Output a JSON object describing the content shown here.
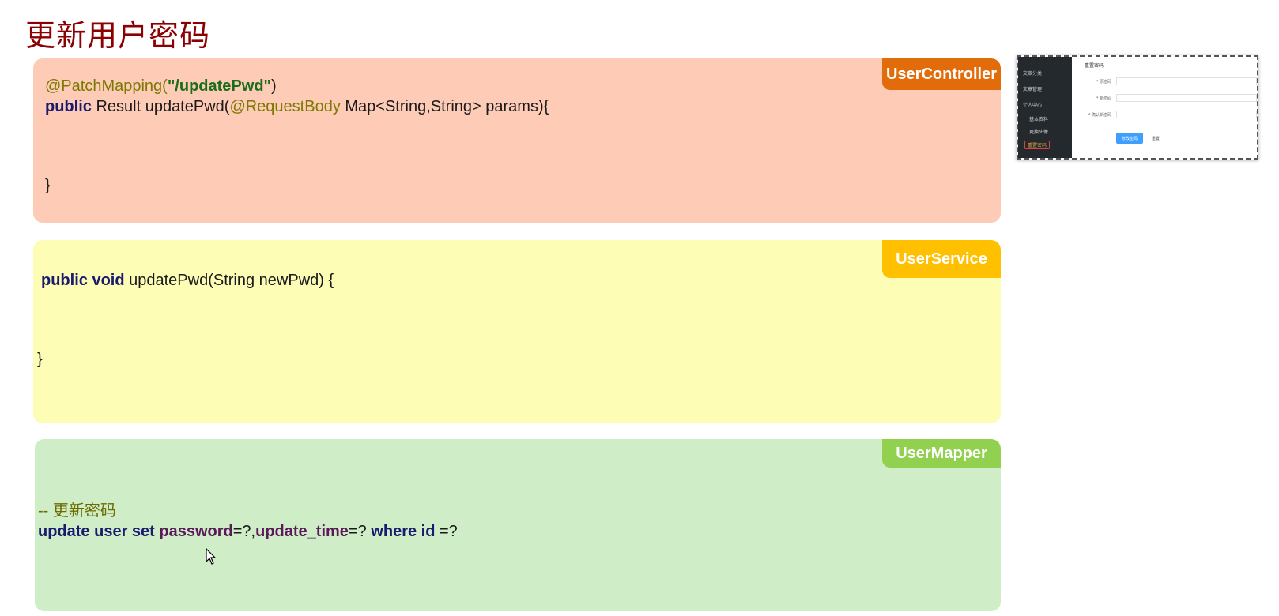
{
  "title": "更新用户密码",
  "controller": {
    "tag": "UserController",
    "annotation": "@PatchMapping(",
    "path": "\"/updatePwd\"",
    "close_paren": ")",
    "kw_public": "public",
    "signature_a": " Result updatePwd(",
    "annotation2": "@RequestBody",
    "signature_b": " Map<String,String> params){",
    "close": "}"
  },
  "service": {
    "tag": "UserService",
    "kw": "public void",
    "signature": " updatePwd(String newPwd) {",
    "close": "}"
  },
  "mapper": {
    "tag": "UserMapper",
    "comment": "-- 更新密码",
    "sql_update": "update user set",
    "col_password": "password",
    "sql_mid": "=?,",
    "col_update_time": "update_time",
    "sql_where_pre": "=?",
    "sql_where": "where id",
    "sql_end": " =?"
  },
  "thumbnail": {
    "sidebar": [
      "文章分类",
      "文章管理",
      "个人中心",
      "基本资料",
      "更换头像",
      "重置密码"
    ],
    "page_title": "重置密码",
    "labels": [
      "* 原密码",
      "* 新密码",
      "* 确认新密码"
    ],
    "primary_button": "修改密码",
    "reset_button": "重置"
  }
}
